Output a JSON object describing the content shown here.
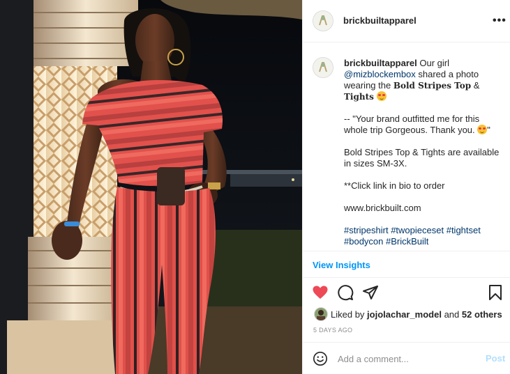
{
  "post": {
    "username": "brickbuiltapparel",
    "more_label": "•••"
  },
  "caption": {
    "username": "brickbuiltapparel",
    "intro": " Our girl ",
    "mention": "@mizblockembox",
    "intro2": " shared a photo wearing the ",
    "product_a": "Bold Stripes Top",
    "amp": " & ",
    "product_b": "Tights",
    "quote": "-- \"Your brand outfitted me for this whole trip Gorgeous. Thank you. ",
    "quote_end": "\"",
    "availability": "Bold Stripes Top & Tights are available in sizes SM-3X.",
    "cta": "**Click link in bio to order",
    "website": "www.brickbuilt.com",
    "hashtags": [
      "#stripeshirt",
      "#twopieceset",
      "#tightset",
      "#bodycon",
      "#BrickBuilt"
    ]
  },
  "insights": {
    "label": "View Insights"
  },
  "actions": {
    "like": "heart-icon",
    "comment": "comment-icon",
    "share": "share-icon",
    "save": "bookmark-icon",
    "like_color": "#ed4956"
  },
  "likes": {
    "prefix": "Liked by ",
    "user": "jojolachar_model",
    "mid": " and ",
    "others": "52 others"
  },
  "timestamp": "5 DAYS AGO",
  "comment": {
    "placeholder": "Add a comment...",
    "post_label": "Post"
  },
  "colors": {
    "link_blue": "#0095f6",
    "hashtag_blue": "#00376b",
    "post_disabled": "#b2dffc"
  }
}
